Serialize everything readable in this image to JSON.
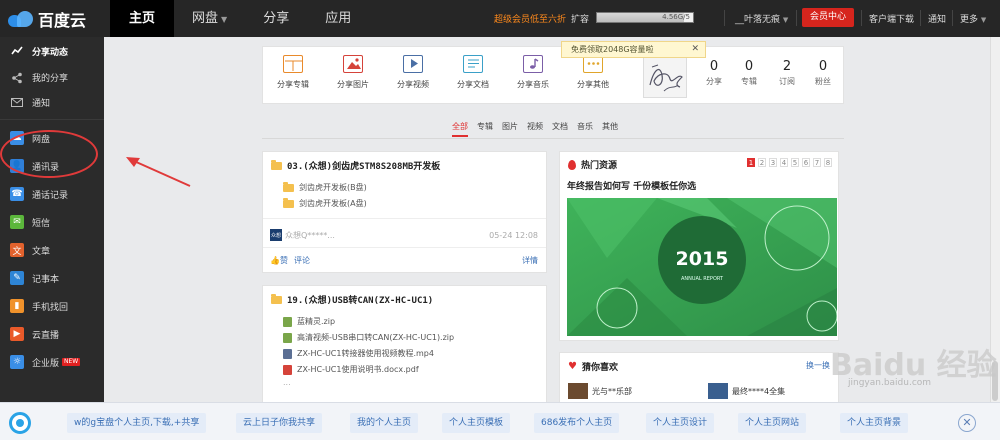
{
  "logo": {
    "text": "百度云"
  },
  "nav": {
    "home": "主页",
    "netdisk": "网盘",
    "share": "分享",
    "apps": "应用"
  },
  "topbar": {
    "promo": "超级会员低至六折",
    "expand": "扩容",
    "quota_text": "4.56G/5",
    "quota_used_fraction": 0.91,
    "username": "__叶落无痕",
    "vip_center": "会员中心",
    "client_download": "客户端下载",
    "notifications": "通知",
    "more": "更多"
  },
  "sidebar": {
    "items": [
      {
        "label": "分享动态",
        "icon": "trend-icon"
      },
      {
        "label": "我的分享",
        "icon": "share-icon"
      },
      {
        "label": "通知",
        "icon": "mail-icon"
      },
      {
        "label": "网盘",
        "icon": "cloud-icon"
      },
      {
        "label": "通讯录",
        "icon": "contacts-icon"
      },
      {
        "label": "通话记录",
        "icon": "call-log-icon"
      },
      {
        "label": "短信",
        "icon": "sms-icon"
      },
      {
        "label": "文章",
        "icon": "article-icon"
      },
      {
        "label": "记事本",
        "icon": "notebook-icon"
      },
      {
        "label": "手机找回",
        "icon": "phone-find-icon"
      },
      {
        "label": "云直播",
        "icon": "live-icon"
      },
      {
        "label": "企业版",
        "icon": "enterprise-icon",
        "badge": "NEW"
      }
    ]
  },
  "share_panel": {
    "buttons": [
      "分享专辑",
      "分享图片",
      "分享视频",
      "分享文档",
      "分享音乐",
      "分享其他"
    ],
    "stats": [
      {
        "num": "0",
        "label": "分享"
      },
      {
        "num": "0",
        "label": "专辑"
      },
      {
        "num": "2",
        "label": "订阅"
      },
      {
        "num": "0",
        "label": "粉丝"
      }
    ]
  },
  "tooltip": {
    "text": "免费领取2048G容量啦",
    "close": "✕"
  },
  "filters": [
    "全部",
    "专辑",
    "图片",
    "视频",
    "文档",
    "音乐",
    "其他"
  ],
  "feed": [
    {
      "title": "03.(众想)剑齿虎STM8S208MB开发板",
      "items": [
        "剑齿虎开发板(B盘)",
        "剑齿虎开发板(A盘)"
      ],
      "author": "众想Q*****...",
      "author_badge": "众想",
      "date": "05-24 12:08",
      "like": "赞",
      "comment": "评论",
      "detail": "详情"
    },
    {
      "title": "19.(众想)USB转CAN(ZX-HC-UC1)",
      "items": [
        "蓝精灵.zip",
        "高清视频-USB串口转CAN(ZX-HC-UC1).zip",
        "ZX-HC-UC1转接器使用视频教程.mp4",
        "ZX-HC-UC1使用说明书.docx.pdf"
      ],
      "more": "..."
    }
  ],
  "hot": {
    "title": "热门资源",
    "pages": [
      "1",
      "2",
      "3",
      "4",
      "5",
      "6",
      "7",
      "8"
    ],
    "headline": "年终报告如何写 千份模板任你选",
    "banner_year": "2015",
    "banner_sub": "ANNUAL  REPORT"
  },
  "guess": {
    "title": "猜你喜欢",
    "more": "换一换",
    "items": [
      "光与**乐部",
      "最终****4全集"
    ]
  },
  "bottombar": {
    "tags": [
      "w的g宝盘个人主页,下载,+共享",
      "云上日子你我共享",
      "我的个人主页",
      "个人主页模板",
      "686发布个人主页",
      "个人主页设计",
      "个人主页网站",
      "个人主页背景"
    ],
    "close": "✕"
  },
  "watermark": {
    "main": "Baidu 经验",
    "sub": "jingyan.baidu.com"
  },
  "colors": {
    "accent_red": "#d6251d",
    "link_blue": "#3a6fb5",
    "promo_orange": "#ff8a1c"
  }
}
